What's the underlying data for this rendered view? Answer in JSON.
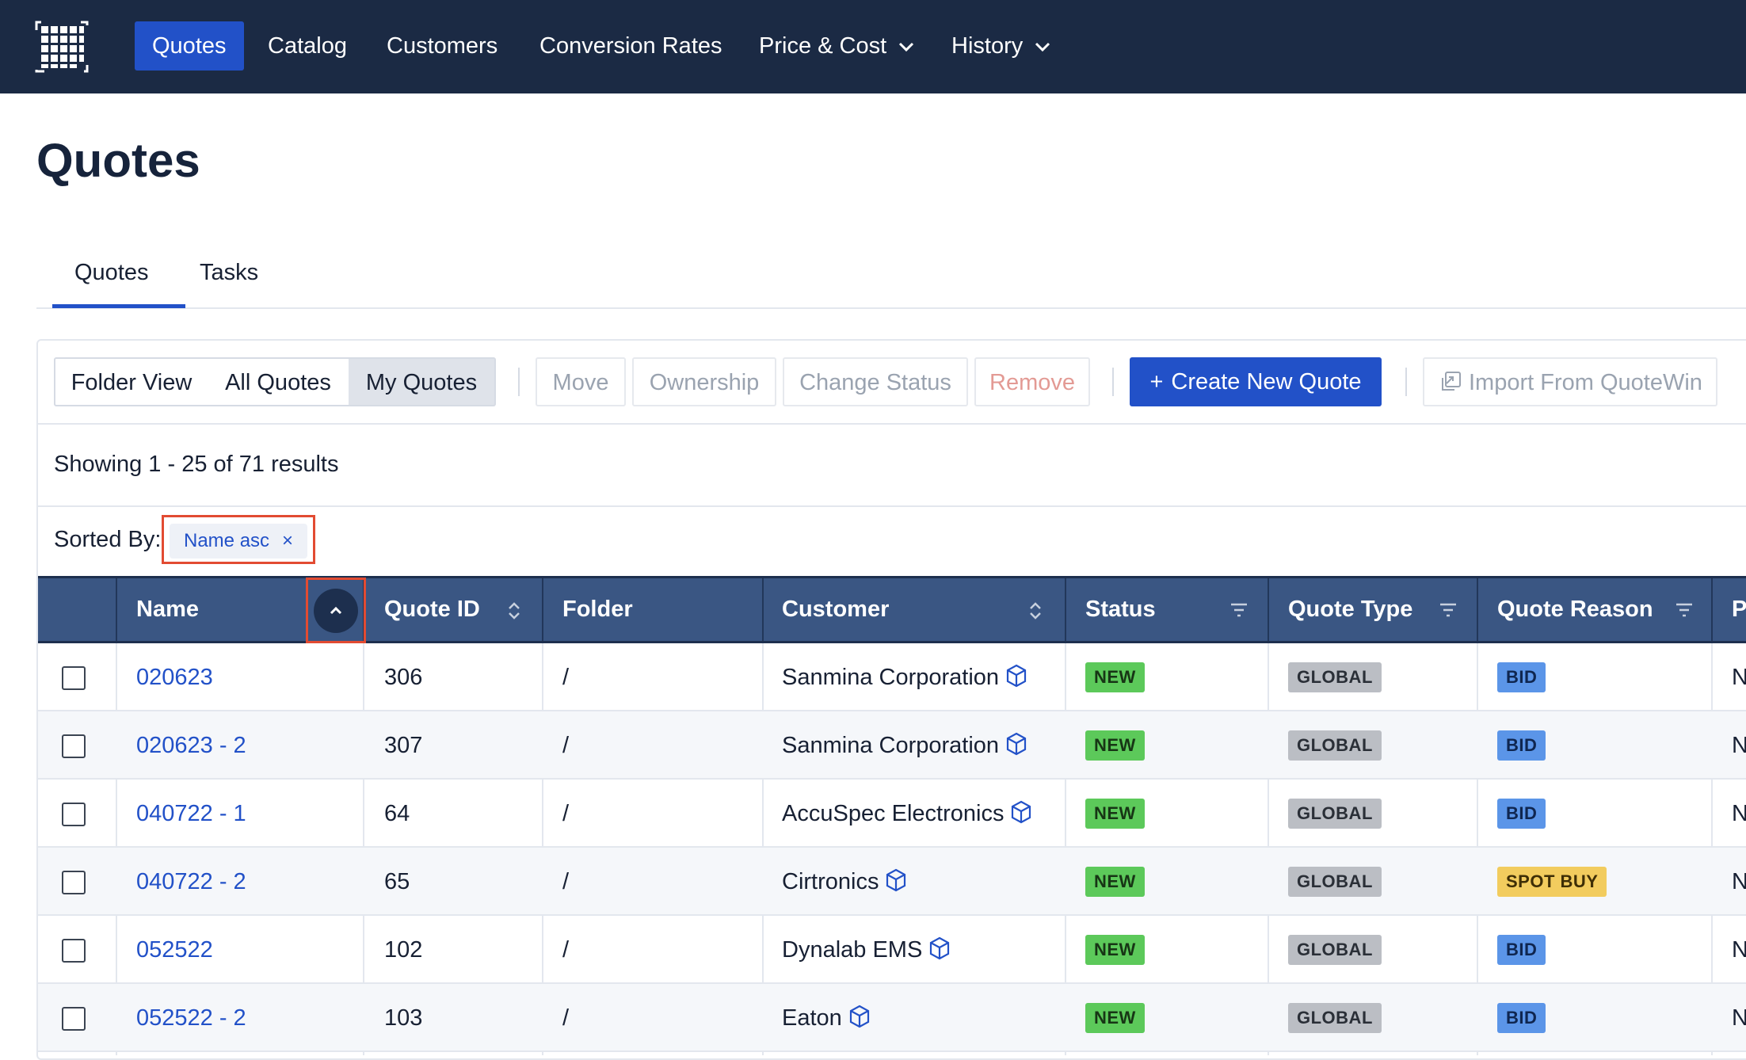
{
  "nav": {
    "items": [
      {
        "label": "Quotes",
        "active": true
      },
      {
        "label": "Catalog"
      },
      {
        "label": "Customers"
      },
      {
        "label": "Conversion Rates"
      },
      {
        "label": "Price & Cost",
        "dropdown": true
      },
      {
        "label": "History",
        "dropdown": true
      }
    ]
  },
  "page": {
    "title": "Quotes"
  },
  "tabs": [
    {
      "label": "Quotes",
      "active": true
    },
    {
      "label": "Tasks"
    }
  ],
  "toolbar": {
    "views": [
      "Folder View",
      "All Quotes",
      "My Quotes"
    ],
    "selected_view": "My Quotes",
    "actions": [
      "Move",
      "Ownership",
      "Change Status",
      "Remove"
    ],
    "create_label": "Create New Quote",
    "create_icon": "+",
    "import_label": "Import From QuoteWin"
  },
  "results_text": "Showing 1 - 25 of 71 results",
  "sort": {
    "label": "Sorted By:",
    "chip": "Name asc",
    "chip_close": "×"
  },
  "table": {
    "columns": [
      "Name",
      "Quote ID",
      "Folder",
      "Customer",
      "Status",
      "Quote Type",
      "Quote Reason",
      "P"
    ],
    "rows": [
      {
        "name": "020623",
        "quote_id": "306",
        "folder": "/",
        "customer": "Sanmina Corporation",
        "status": "NEW",
        "type": "GLOBAL",
        "reason": "BID",
        "extra": "N"
      },
      {
        "name": "020623 - 2",
        "quote_id": "307",
        "folder": "/",
        "customer": "Sanmina Corporation",
        "status": "NEW",
        "type": "GLOBAL",
        "reason": "BID",
        "extra": "N"
      },
      {
        "name": "040722 - 1",
        "quote_id": "64",
        "folder": "/",
        "customer": "AccuSpec Electronics",
        "status": "NEW",
        "type": "GLOBAL",
        "reason": "BID",
        "extra": "N"
      },
      {
        "name": "040722 - 2",
        "quote_id": "65",
        "folder": "/",
        "customer": "Cirtronics",
        "status": "NEW",
        "type": "GLOBAL",
        "reason": "SPOT BUY",
        "extra": "N"
      },
      {
        "name": "052522",
        "quote_id": "102",
        "folder": "/",
        "customer": "Dynalab EMS",
        "status": "NEW",
        "type": "GLOBAL",
        "reason": "BID",
        "extra": "N"
      },
      {
        "name": "052522 - 2",
        "quote_id": "103",
        "folder": "/",
        "customer": "Eaton",
        "status": "NEW",
        "type": "GLOBAL",
        "reason": "BID",
        "extra": "N"
      }
    ]
  },
  "colors": {
    "nav_bg": "#1b2a44",
    "accent": "#2251c8",
    "header_bg": "#3a5683",
    "highlight": "#e24b32"
  }
}
